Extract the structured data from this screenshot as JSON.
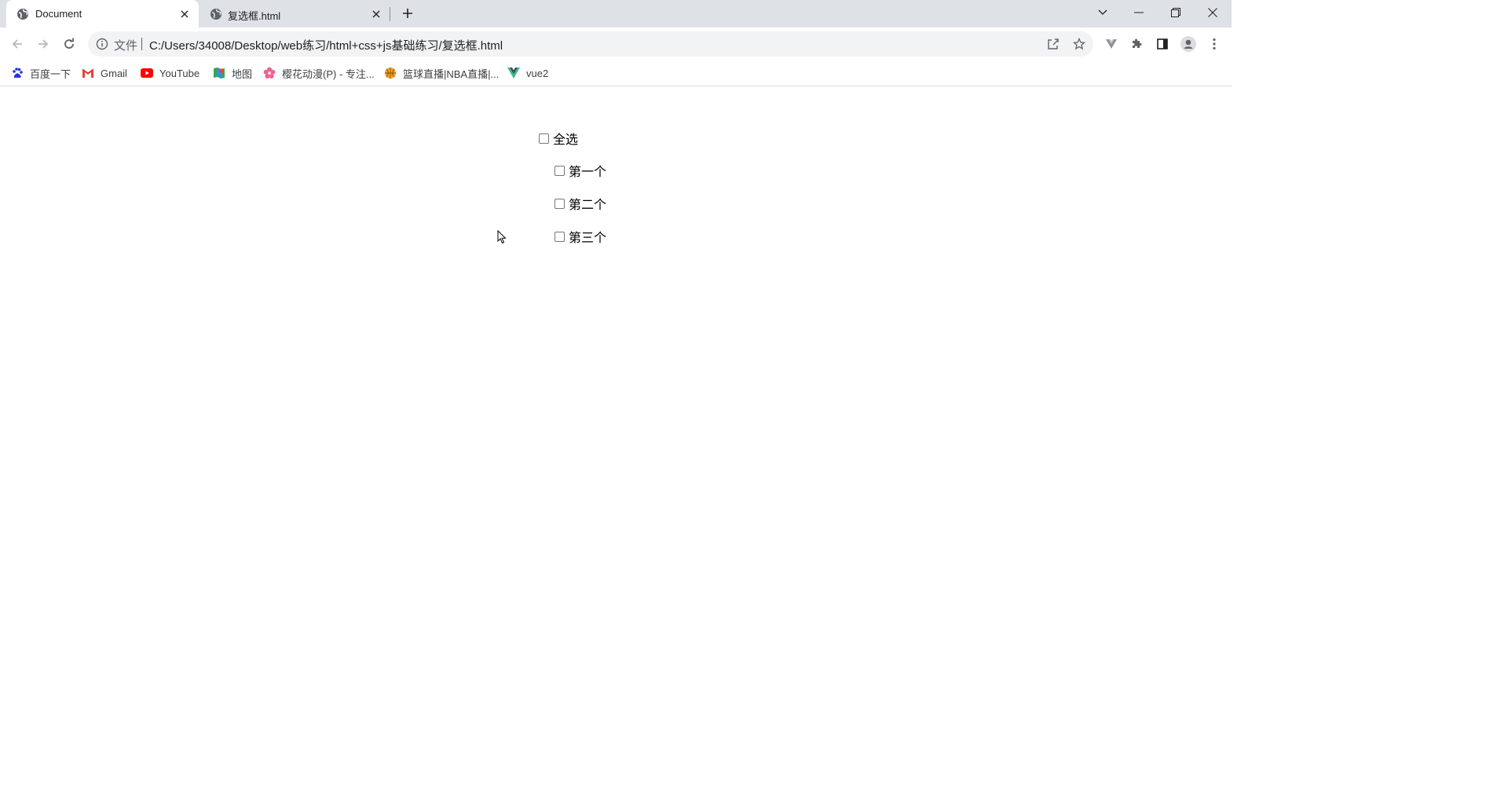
{
  "browser": {
    "tabs": [
      {
        "title": "Document",
        "active": true,
        "icon": "globe-icon"
      },
      {
        "title": "复选框.html",
        "active": false,
        "icon": "globe-icon"
      }
    ],
    "address": {
      "scheme_label": "文件",
      "url": "C:/Users/34008/Desktop/web练习/html+css+js基础练习/复选框.html"
    },
    "bookmarks": [
      {
        "label": "百度一下",
        "icon": "baidu-icon"
      },
      {
        "label": "Gmail",
        "icon": "gmail-icon"
      },
      {
        "label": "YouTube",
        "icon": "youtube-icon"
      },
      {
        "label": "地图",
        "icon": "maps-icon"
      },
      {
        "label": "樱花动漫(P) - 专注...",
        "icon": "sakura-icon"
      },
      {
        "label": "篮球直播|NBA直播|...",
        "icon": "basketball-icon"
      },
      {
        "label": "vue2",
        "icon": "vue-icon"
      }
    ]
  },
  "page": {
    "select_all": {
      "label": "全选",
      "checked": false
    },
    "items": [
      {
        "label": "第一个",
        "checked": false
      },
      {
        "label": "第二个",
        "checked": false
      },
      {
        "label": "第三个",
        "checked": false
      }
    ]
  },
  "colors": {
    "tabstrip": "#dee1e6",
    "omnibox": "#f1f3f4",
    "youtube": "#ff0000",
    "gmail": "#ea4335",
    "vue": "#41b883",
    "baidu": "#2932e1"
  }
}
